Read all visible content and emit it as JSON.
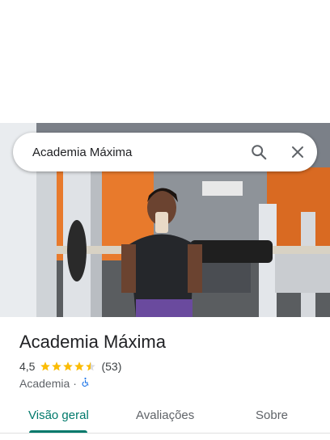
{
  "search": {
    "query": "Academia Máxima",
    "search_icon": "search-icon",
    "clear_icon": "close-icon"
  },
  "place": {
    "name": "Academia Máxima",
    "rating": "4,5",
    "stars": 4.5,
    "review_count": "(53)",
    "category": "Academia",
    "separator": "·",
    "accessibility_icon": "wheelchair-icon"
  },
  "tabs": [
    {
      "label": "Visão geral",
      "active": true
    },
    {
      "label": "Avaliações",
      "active": false
    },
    {
      "label": "Sobre",
      "active": false
    }
  ],
  "colors": {
    "accent": "#00796b",
    "star": "#fbbc04",
    "accessibility": "#1a73e8"
  }
}
